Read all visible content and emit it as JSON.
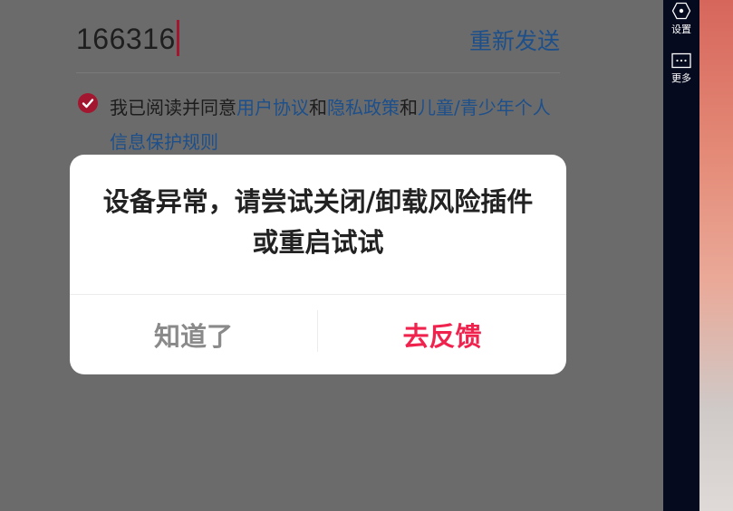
{
  "login": {
    "code_value": "166316",
    "resend_label": "重新发送",
    "agreement": {
      "prefix": "我已阅读并同意",
      "user_agreement": "用户协议",
      "and1": "和",
      "privacy_policy": "隐私政策",
      "and2": "和",
      "child_policy": "儿童/青少年个人信息保护规则"
    }
  },
  "dialog": {
    "message": "设备异常，请尝试关闭/卸载风险插件或重启试试",
    "dismiss_label": "知道了",
    "feedback_label": "去反馈"
  },
  "sidebar": {
    "items": [
      {
        "label": "设置",
        "icon": "settings-icon"
      },
      {
        "label": "更多",
        "icon": "more-icon"
      }
    ]
  },
  "colors": {
    "accent_red": "#f0234e",
    "link_blue": "#1d4f8a",
    "sidebar_bg": "#060a1f",
    "checkbox_red": "#a3162f"
  }
}
